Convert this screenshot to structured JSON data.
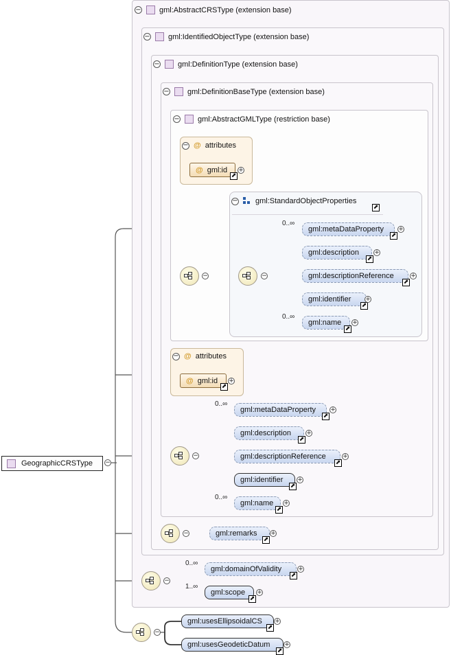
{
  "root_type": {
    "label": "GeographicCRSType"
  },
  "extensions": {
    "abstract_crs": "gml:AbstractCRSType (extension base)",
    "identified_object": "gml:IdentifiedObjectType (extension base)",
    "definition": "gml:DefinitionType (extension base)",
    "definition_base": "gml:DefinitionBaseType (extension base)",
    "abstract_gml": "gml:AbstractGMLType (restriction base)"
  },
  "attributes_inner": {
    "title": "attributes",
    "item": "gml:id"
  },
  "standard_object_properties": {
    "title": "gml:StandardObjectProperties",
    "elements": [
      {
        "name": "gml:metaDataProperty",
        "multiplicity": "0..∞"
      },
      {
        "name": "gml:description",
        "multiplicity": ""
      },
      {
        "name": "gml:descriptionReference",
        "multiplicity": ""
      },
      {
        "name": "gml:identifier",
        "multiplicity": ""
      },
      {
        "name": "gml:name",
        "multiplicity": "0..∞"
      }
    ]
  },
  "attributes_outer": {
    "title": "attributes",
    "item": "gml:id"
  },
  "definition_base_sequence": [
    {
      "name": "gml:metaDataProperty",
      "multiplicity": "0..∞"
    },
    {
      "name": "gml:description",
      "multiplicity": ""
    },
    {
      "name": "gml:descriptionReference",
      "multiplicity": ""
    },
    {
      "name": "gml:identifier",
      "multiplicity": ""
    },
    {
      "name": "gml:name",
      "multiplicity": "0..∞"
    }
  ],
  "definition_sequence": [
    {
      "name": "gml:remarks",
      "multiplicity": ""
    }
  ],
  "crs_sequence": [
    {
      "name": "gml:domainOfValidity",
      "multiplicity": "0..∞"
    },
    {
      "name": "gml:scope",
      "multiplicity": "1..∞"
    }
  ],
  "geographic_sequence": [
    {
      "name": "gml:usesEllipsoidalCS",
      "multiplicity": ""
    },
    {
      "name": "gml:usesGeodeticDatum",
      "multiplicity": ""
    }
  ],
  "icons": {
    "type": "type-square-icon",
    "collapse": "collapse-minus-icon",
    "expand": "expand-plus-icon",
    "link": "link-arrow-icon",
    "sequence": "sequence-compositor-icon",
    "attribute": "attribute-at-icon",
    "group": "group-icon"
  },
  "colors": {
    "element_fill": "#c8d6ef",
    "attribute_fill": "#f3dcb5",
    "compositor_fill": "#efe6b6",
    "type_fill": "#eadcf0"
  }
}
